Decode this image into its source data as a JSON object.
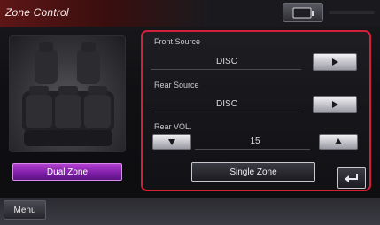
{
  "header": {
    "title": "Zone Control"
  },
  "seat_area": {
    "dual_zone_label": "Dual Zone"
  },
  "panel": {
    "front_source": {
      "label": "Front Source",
      "value": "DISC"
    },
    "rear_source": {
      "label": "Rear Source",
      "value": "DISC"
    },
    "rear_vol": {
      "label": "Rear VOL.",
      "value": "15"
    },
    "single_zone_label": "Single Zone"
  },
  "footer": {
    "menu_label": "Menu"
  },
  "colors": {
    "highlight_border": "#d3203a",
    "dual_zone_active": "#9b32c4"
  }
}
